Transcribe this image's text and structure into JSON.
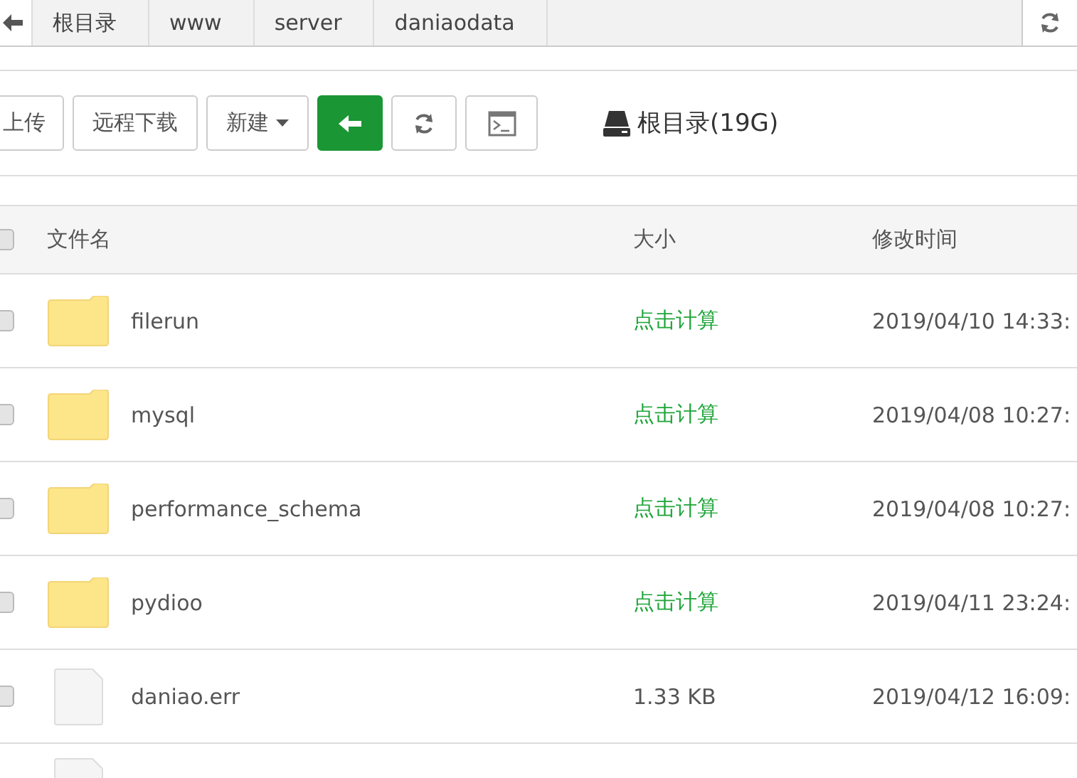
{
  "breadcrumb": {
    "items": [
      {
        "label": "根目录"
      },
      {
        "label": "www"
      },
      {
        "label": "server"
      },
      {
        "label": "daniaodata"
      }
    ]
  },
  "toolbar": {
    "buttons": [
      {
        "kind": "text",
        "label": "上传"
      },
      {
        "kind": "text",
        "label": "远程下载"
      },
      {
        "kind": "dropdown",
        "label": "新建"
      },
      {
        "kind": "back"
      },
      {
        "kind": "refresh"
      },
      {
        "kind": "terminal"
      }
    ],
    "disk": "根目录(19G)"
  },
  "table": {
    "columns": [
      "文件名",
      "大小",
      "修改时间"
    ],
    "checked": false,
    "rows": [
      {
        "kind": "folder",
        "name": "filerun",
        "size": "点击计算",
        "size_link": true,
        "modified": "2019/04/10 14:33:",
        "checked": false
      },
      {
        "kind": "folder",
        "name": "mysql",
        "size": "点击计算",
        "size_link": true,
        "modified": "2019/04/08 10:27:",
        "checked": false
      },
      {
        "kind": "folder",
        "name": "performance_schema",
        "size": "点击计算",
        "size_link": true,
        "modified": "2019/04/08 10:27:",
        "checked": false
      },
      {
        "kind": "folder",
        "name": "pydioo",
        "size": "点击计算",
        "size_link": true,
        "modified": "2019/04/11 23:24:",
        "checked": false
      },
      {
        "kind": "file",
        "name": "daniao.err",
        "size": "1.33 KB",
        "size_link": false,
        "modified": "2019/04/12 16:09:",
        "checked": false
      },
      {
        "kind": "file"
      }
    ]
  }
}
